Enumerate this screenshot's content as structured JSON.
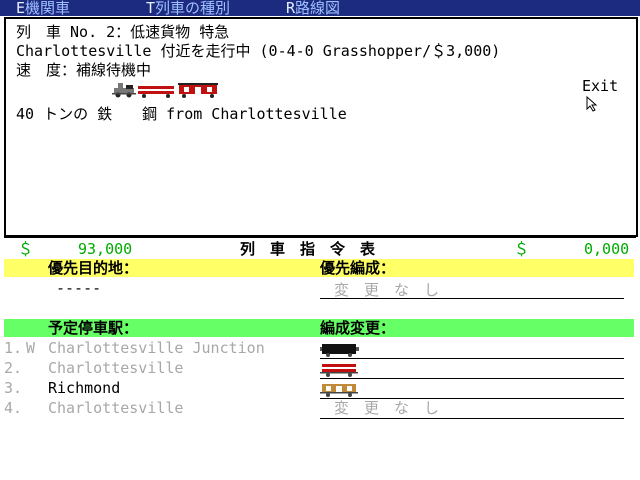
{
  "menu": {
    "items": [
      {
        "key": "E",
        "label": "機関車"
      },
      {
        "key": "T",
        "label": "列車の種別"
      },
      {
        "key": "R",
        "label": "路線図"
      }
    ]
  },
  "train_info": {
    "line1": "列　車 No. 2：低速貨物 特急",
    "line2": "Charlottesville 付近を走行中 (0-4-0 Grasshopper/＄3,000)",
    "line3": "速　度：補線待機中",
    "cargo_line": "40 トンの 鉄　　鋼 from Charlottesville",
    "exit_label": "Exit"
  },
  "orders": {
    "money_left_symbol": "＄",
    "money_left": "93,000",
    "title": "列　車　指　令　表",
    "money_right_symbol": "＄",
    "money_right": "0,000",
    "priority_destination_label": "優先目的地：",
    "priority_destination_value": "-----",
    "priority_consist_label": "優先編成：",
    "priority_consist_value": "変　更　な　し",
    "scheduled_stops_label": "予定停車駅：",
    "consist_change_label": "編成変更：",
    "stops": [
      {
        "num": "1.",
        "marker": "W",
        "name": "Charlottesville Junction",
        "consist": "coal-car"
      },
      {
        "num": "2.",
        "marker": "",
        "name": "Charlottesville",
        "consist": "flat-car"
      },
      {
        "num": "3.",
        "marker": "",
        "name": "Richmond",
        "consist": "goods-car"
      },
      {
        "num": "4.",
        "marker": "",
        "name": "Charlottesville",
        "consist": "変　更　な　し"
      }
    ]
  },
  "colors": {
    "menubar": "#1c2a80",
    "priority_band": "#ffff66",
    "stops_band": "#66ff66",
    "money": "#00aa00",
    "inactive_text": "#a8a8a8"
  }
}
